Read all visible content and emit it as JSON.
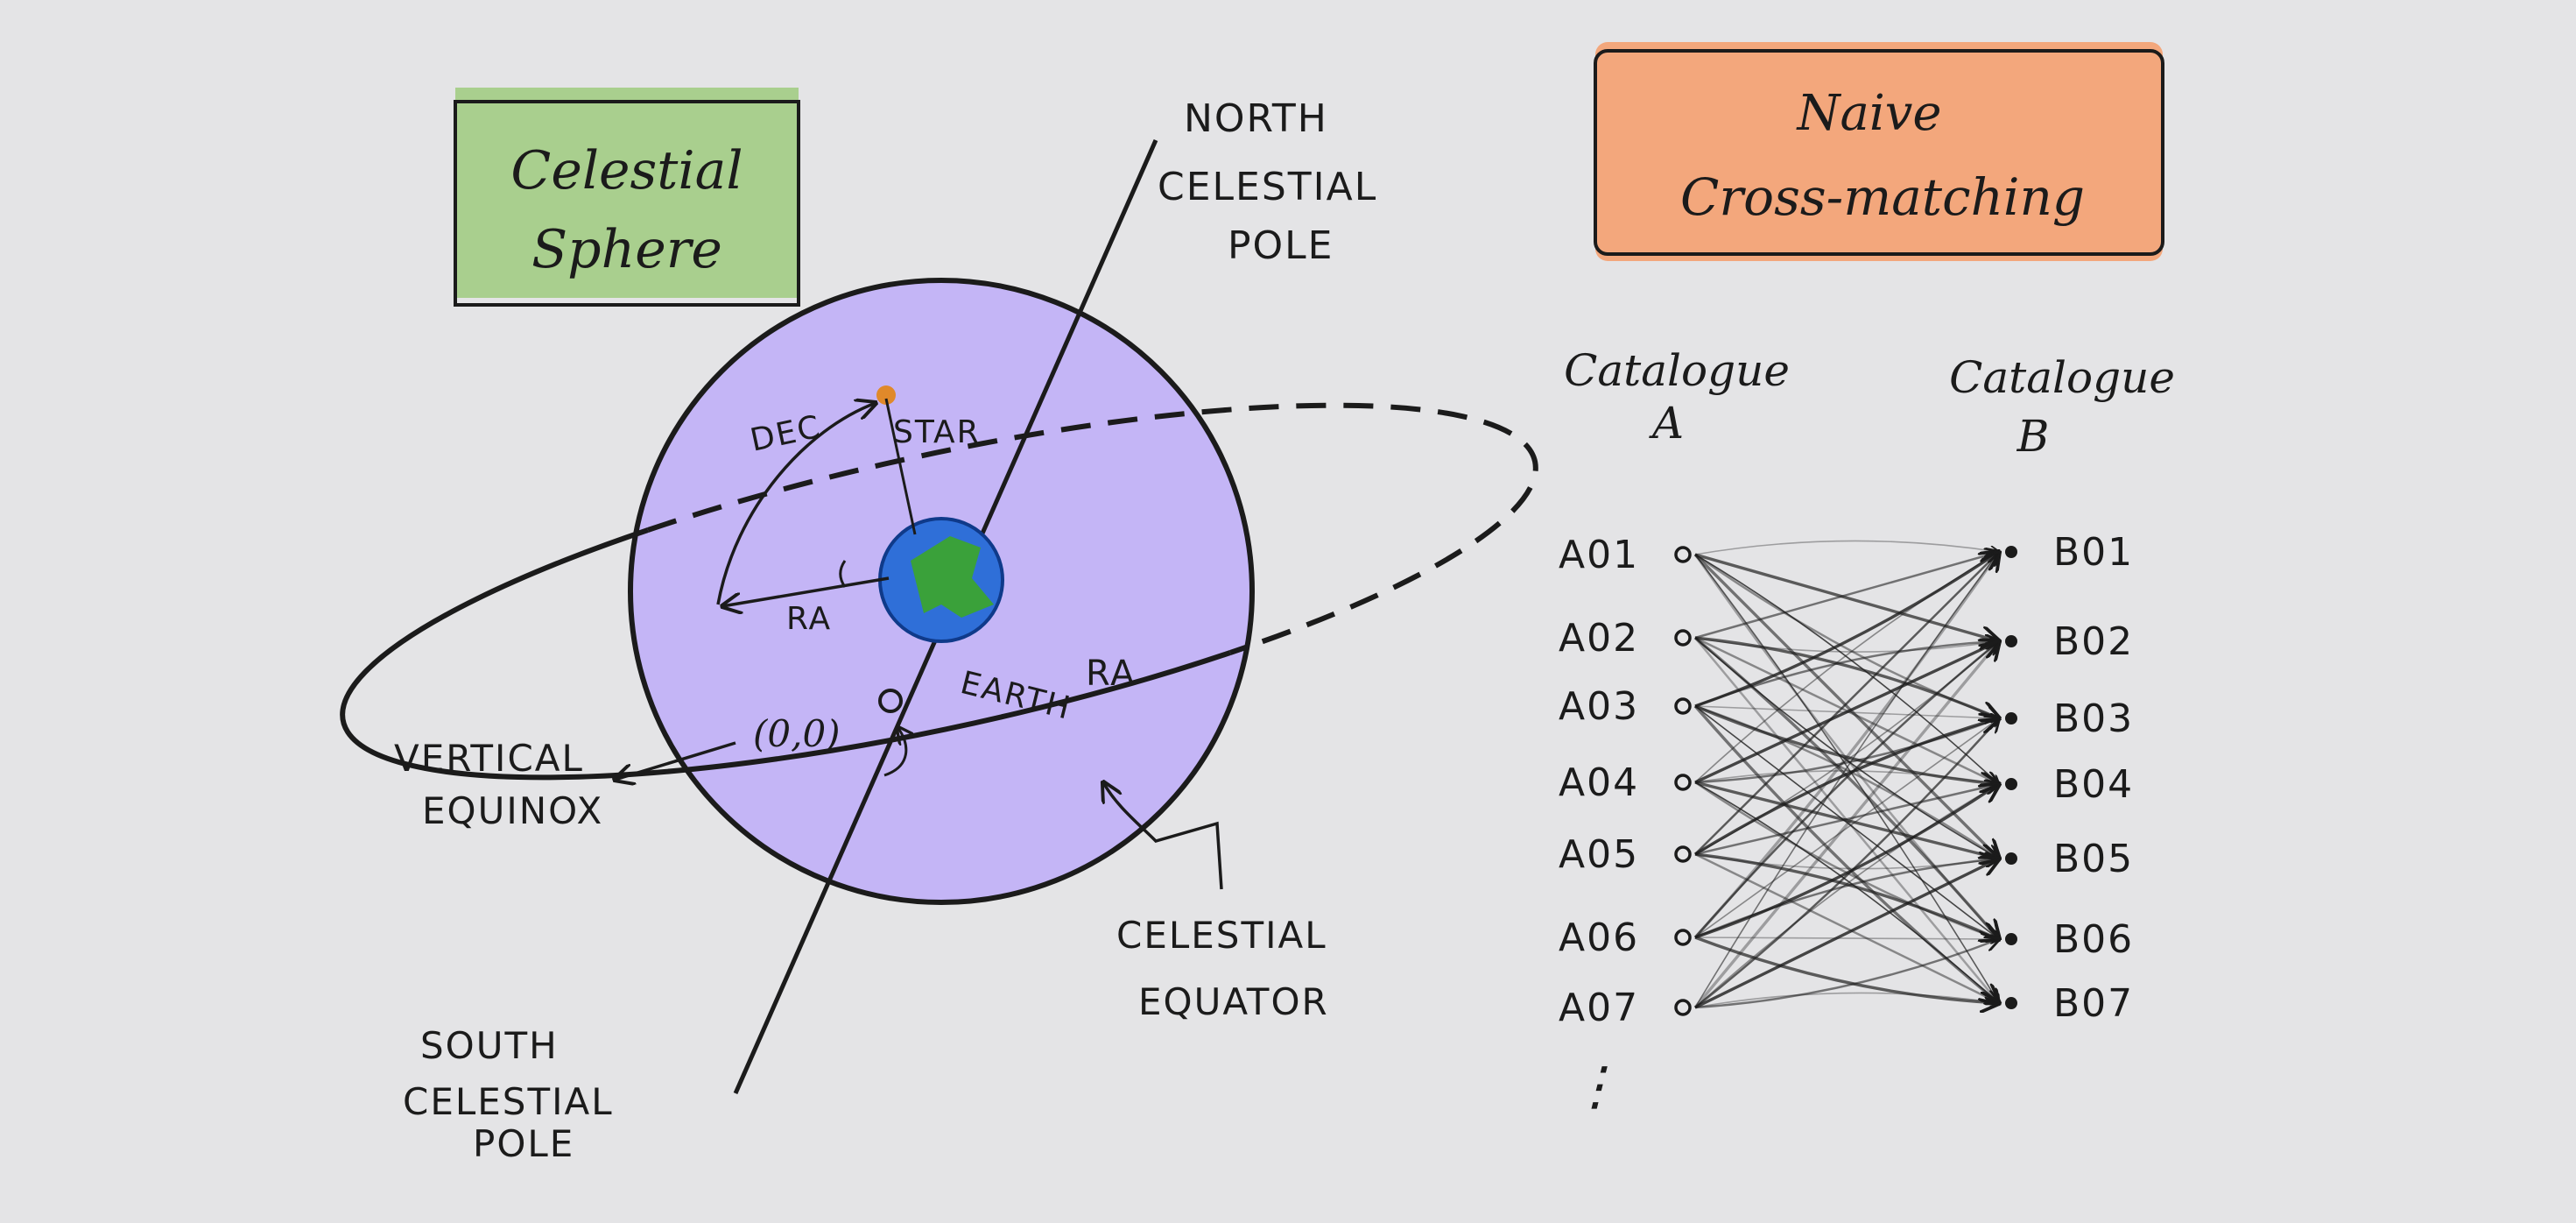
{
  "left_panel": {
    "title_line1": "Celestial",
    "title_line2": "Sphere",
    "title_fill": "#a9cf8e",
    "sphere_fill": "#c4b5f6",
    "earth_blue": "#2f6fd8",
    "earth_green": "#3aa13a",
    "star_color": "#e0892a",
    "labels": {
      "north_line1": "NORTH",
      "north_line2": "CELESTIAL",
      "north_line3": "POLE",
      "south_line1": "SOUTH",
      "south_line2": "CELESTIAL",
      "south_line3": "POLE",
      "vertical_line1": "VERTICAL",
      "vertical_line2": "EQUINOX",
      "equator_line1": "CELESTIAL",
      "equator_line2": "EQUATOR",
      "dec": "DEC",
      "star": "STAR",
      "ra_left": "RA",
      "ra_right": "RA",
      "earth": "EARTH",
      "origin": "(0,0)"
    }
  },
  "right_panel": {
    "title_line1": "Naive",
    "title_line2": "Cross-matching",
    "title_fill": "#f3a77c",
    "catalogue_a_line1": "Catalogue",
    "catalogue_a_line2": "A",
    "catalogue_b_line1": "Catalogue",
    "catalogue_b_line2": "B",
    "a_items": [
      "A01",
      "A02",
      "A03",
      "A04",
      "A05",
      "A06",
      "A07"
    ],
    "b_items": [
      "B01",
      "B02",
      "B03",
      "B04",
      "B05",
      "B06",
      "B07"
    ],
    "ellipsis": "⋮"
  }
}
